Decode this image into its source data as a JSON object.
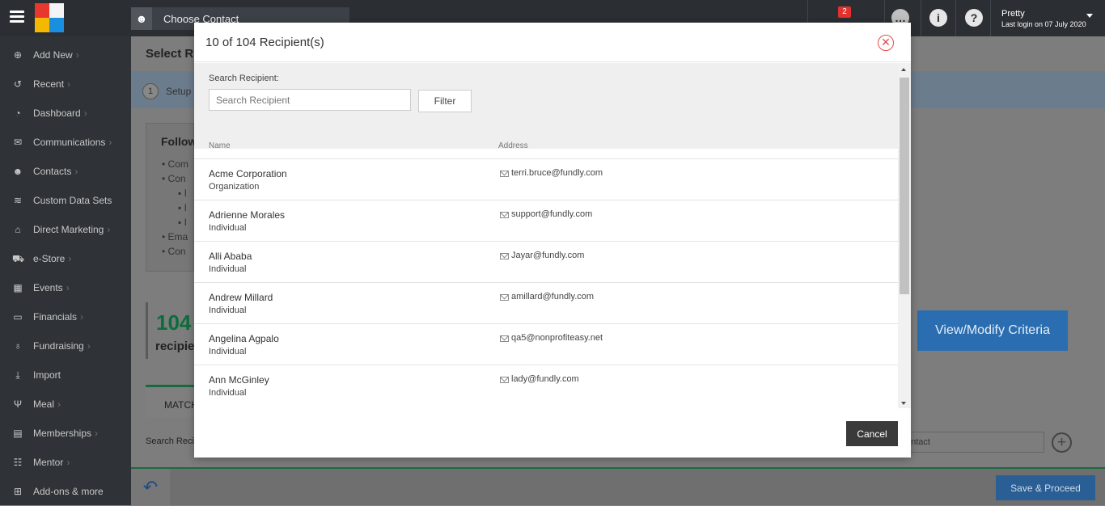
{
  "topbar": {
    "choose_contact": "Choose Contact",
    "notification_count": "2",
    "user_name": "Pretty",
    "last_login": "Last login on 07 July 2020"
  },
  "sidebar": {
    "items": [
      {
        "label": "Add New",
        "icon": "plus-circle-icon",
        "chevron": true
      },
      {
        "label": "Recent",
        "icon": "history-icon",
        "chevron": true
      },
      {
        "label": "Dashboard",
        "icon": "dashboard-icon",
        "chevron": true
      },
      {
        "label": "Communications",
        "icon": "envelope-icon",
        "chevron": true
      },
      {
        "label": "Contacts",
        "icon": "user-icon",
        "chevron": true
      },
      {
        "label": "Custom Data Sets",
        "icon": "database-icon",
        "chevron": false
      },
      {
        "label": "Direct Marketing",
        "icon": "bank-icon",
        "chevron": true
      },
      {
        "label": "e-Store",
        "icon": "cart-icon",
        "chevron": true
      },
      {
        "label": "Events",
        "icon": "calendar-icon",
        "chevron": true
      },
      {
        "label": "Financials",
        "icon": "money-icon",
        "chevron": true
      },
      {
        "label": "Fundraising",
        "icon": "moneybag-icon",
        "chevron": true
      },
      {
        "label": "Import",
        "icon": "download-icon",
        "chevron": false
      },
      {
        "label": "Meal",
        "icon": "cutlery-icon",
        "chevron": true
      },
      {
        "label": "Memberships",
        "icon": "idcard-icon",
        "chevron": true
      },
      {
        "label": "Mentor",
        "icon": "people-icon",
        "chevron": true
      },
      {
        "label": "Add-ons & more",
        "icon": "grid-icon",
        "chevron": false
      }
    ]
  },
  "background": {
    "page_title": "Select Re",
    "step_number": "1",
    "step_label": "Setup",
    "follow_title": "Follow",
    "list_items": [
      "Com",
      "Con",
      "I",
      "I",
      "I",
      "Ema",
      "Con"
    ],
    "count": "104",
    "count_label": "recipie",
    "view_criteria": "View/Modify Criteria",
    "tab_match": "MATCH",
    "search_label": "Search Recip",
    "contact_input": "ontact",
    "save_proceed": "Save & Proceed"
  },
  "modal": {
    "title": "10 of 104 Recipient(s)",
    "search_label": "Search Recipient:",
    "search_placeholder": "Search Recipient",
    "filter_label": "Filter",
    "col_name": "Name",
    "col_address": "Address",
    "cancel_label": "Cancel",
    "rows": [
      {
        "name": "Acme Corporation",
        "type": "Organization",
        "address": "terri.bruce@fundly.com"
      },
      {
        "name": "Adrienne Morales",
        "type": "Individual",
        "address": "support@fundly.com"
      },
      {
        "name": "Alli Ababa",
        "type": "Individual",
        "address": "Jayar@fundly.com"
      },
      {
        "name": "Andrew Millard",
        "type": "Individual",
        "address": "amillard@fundly.com"
      },
      {
        "name": "Angelina Agpalo",
        "type": "Individual",
        "address": "qa5@nonprofiteasy.net"
      },
      {
        "name": "Ann McGinley",
        "type": "Individual",
        "address": "lady@fundly.com"
      }
    ]
  }
}
